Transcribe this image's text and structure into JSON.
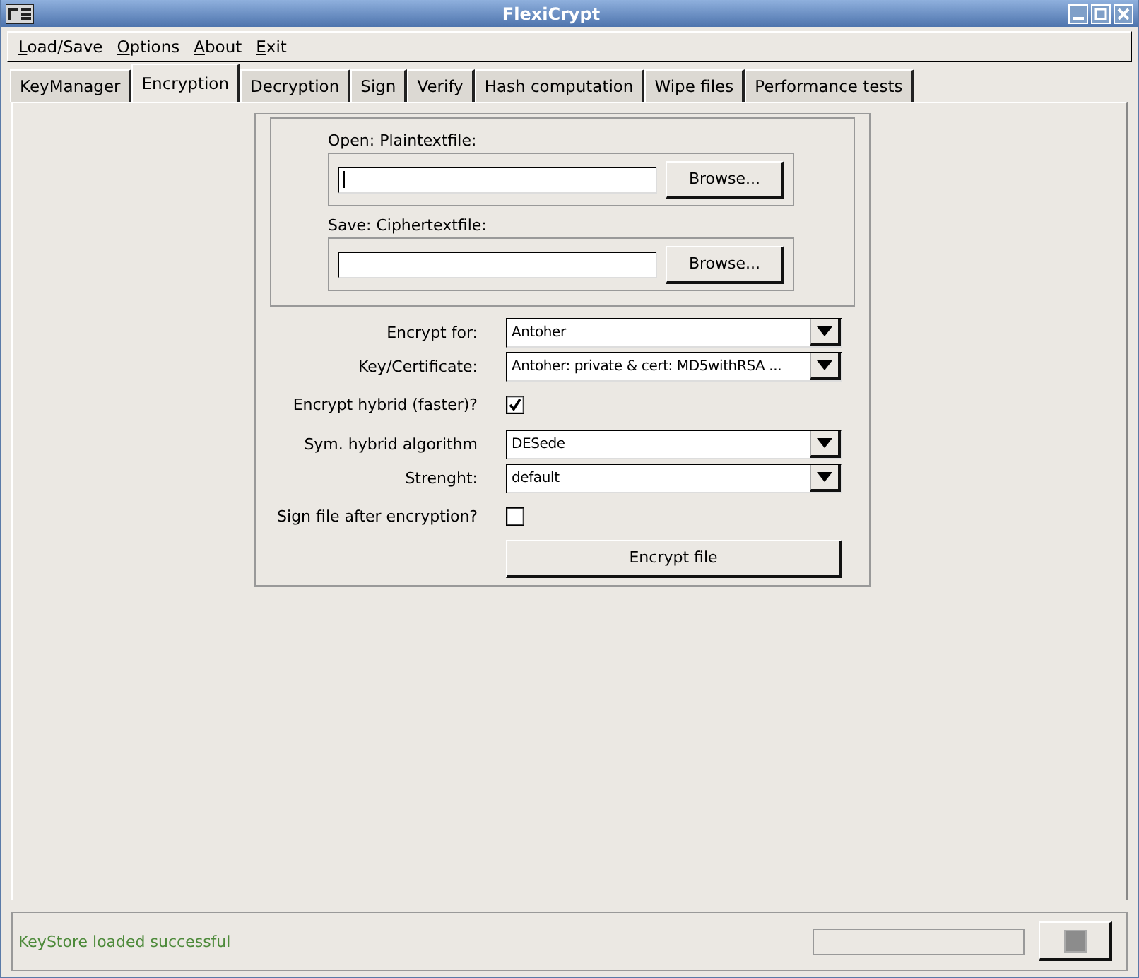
{
  "window": {
    "title": "FlexiCrypt"
  },
  "menu": [
    "Load/Save",
    "Options",
    "About",
    "Exit"
  ],
  "tabs": [
    {
      "label": "KeyManager",
      "selected": false
    },
    {
      "label": "Encryption",
      "selected": true
    },
    {
      "label": "Decryption",
      "selected": false
    },
    {
      "label": "Sign",
      "selected": false
    },
    {
      "label": "Verify",
      "selected": false
    },
    {
      "label": "Hash computation",
      "selected": false
    },
    {
      "label": "Wipe files",
      "selected": false
    },
    {
      "label": "Performance tests",
      "selected": false
    }
  ],
  "files": [
    {
      "label": "Open: Plaintextfile:",
      "button": "Browse...",
      "focused": true
    },
    {
      "label": "Save: Ciphertextfile:",
      "button": "Browse...",
      "focused": false
    }
  ],
  "options": [
    {
      "kind": "combo",
      "label": "Encrypt for:",
      "value": "Antoher"
    },
    {
      "kind": "combo",
      "label": "Key/Certificate:",
      "value": "Antoher: private & cert: MD5withRSA ..."
    },
    {
      "kind": "check",
      "label": "Encrypt hybrid (faster)?",
      "checked": true
    },
    {
      "kind": "combo",
      "label": "Sym. hybrid algorithm",
      "value": "DESede"
    },
    {
      "kind": "combo",
      "label": "Strenght:",
      "value": "default"
    },
    {
      "kind": "check",
      "label": "Sign file after encryption?",
      "checked": false
    }
  ],
  "action_button": "Encrypt file",
  "status_bar": {
    "message": "KeyStore loaded successful",
    "progress": {
      "level": 0
    }
  }
}
